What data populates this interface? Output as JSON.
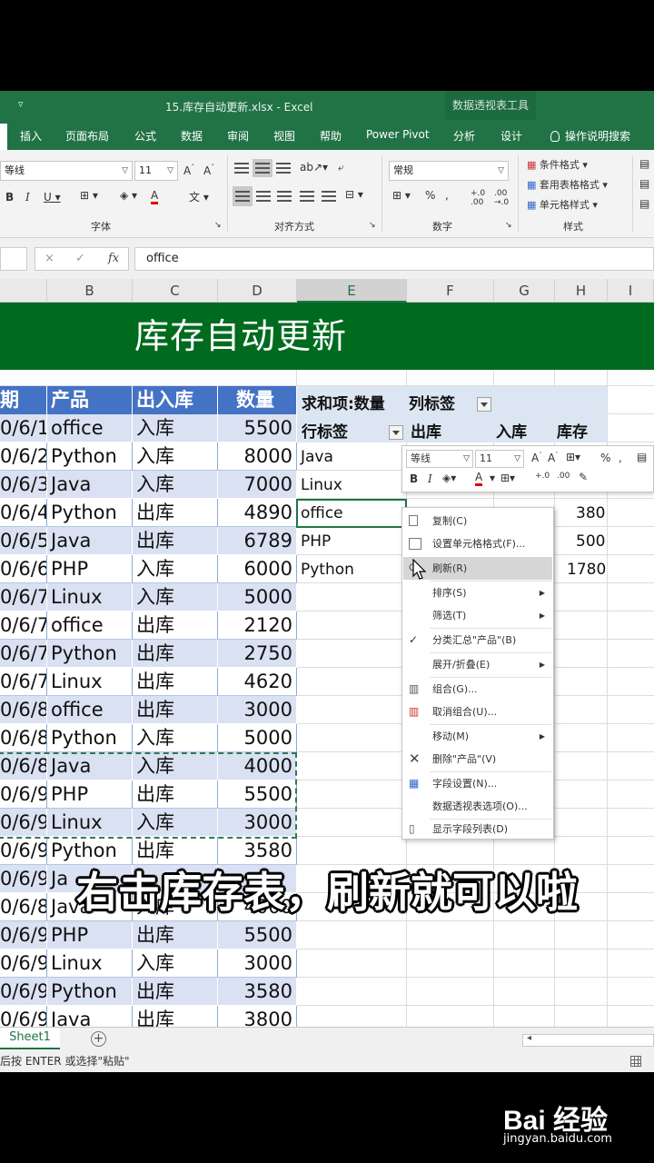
{
  "window": {
    "title": "15.库存自动更新.xlsx  -  Excel",
    "context_tools": "数据透视表工具",
    "quick_access": "▿"
  },
  "ribbon_tabs": [
    "插入",
    "页面布局",
    "公式",
    "数据",
    "审阅",
    "视图",
    "帮助",
    "Power Pivot",
    "分析",
    "设计"
  ],
  "tell_me": "操作说明搜索",
  "ribbon": {
    "font_name": "等线",
    "font_size": "11",
    "font_group": "字体",
    "align_group": "对齐方式",
    "number_format": "常规",
    "number_group": "数字",
    "styles": [
      "条件格式 ▾",
      "套用表格格式 ▾",
      "单元格样式 ▾"
    ],
    "styles_group": "样式"
  },
  "formula_bar": {
    "value": "office",
    "fx": "fx",
    "cancel": "×",
    "enter": "✓"
  },
  "columns": [
    "B",
    "C",
    "D",
    "E",
    "F",
    "G",
    "H",
    "I"
  ],
  "banner_title": "库存自动更新",
  "table": {
    "headers": [
      "期",
      "产品",
      "出入库",
      "数量"
    ],
    "rows": [
      [
        "0/6/1",
        "office",
        "入库",
        "5500"
      ],
      [
        "0/6/2",
        "Python",
        "入库",
        "8000"
      ],
      [
        "0/6/3",
        "Java",
        "入库",
        "7000"
      ],
      [
        "0/6/4",
        "Python",
        "出库",
        "4890"
      ],
      [
        "0/6/5",
        "Java",
        "出库",
        "6789"
      ],
      [
        "0/6/6",
        "PHP",
        "入库",
        "6000"
      ],
      [
        "0/6/7",
        "Linux",
        "入库",
        "5000"
      ],
      [
        "0/6/7",
        "office",
        "出库",
        "2120"
      ],
      [
        "0/6/7",
        "Python",
        "出库",
        "2750"
      ],
      [
        "0/6/7",
        "Linux",
        "出库",
        "4620"
      ],
      [
        "0/6/8",
        "office",
        "出库",
        "3000"
      ],
      [
        "0/6/8",
        "Python",
        "入库",
        "5000"
      ],
      [
        "0/6/8",
        "Java",
        "入库",
        "4000"
      ],
      [
        "0/6/9",
        "PHP",
        "出库",
        "5500"
      ],
      [
        "0/6/9",
        "Linux",
        "入库",
        "3000"
      ],
      [
        "0/6/9",
        "Python",
        "出库",
        "3580"
      ],
      [
        "0/6/9",
        "Ja",
        "",
        ""
      ],
      [
        "0/6/8",
        "Java",
        "入库",
        "4000"
      ],
      [
        "0/6/9",
        "PHP",
        "出库",
        "5500"
      ],
      [
        "0/6/9",
        "Linux",
        "入库",
        "3000"
      ],
      [
        "0/6/9",
        "Python",
        "出库",
        "3580"
      ],
      [
        "0/6/9",
        "Java",
        "出库",
        "3800"
      ]
    ]
  },
  "pivot": {
    "values_label": "求和项:数量",
    "col_label": "列标签",
    "row_label": "行标签",
    "col_headers": [
      "出库",
      "入库",
      "库存"
    ],
    "row_items": [
      "Java",
      "Linux",
      "office",
      "PHP",
      "Python"
    ],
    "visible_stock": [
      "380",
      "500",
      "1780"
    ]
  },
  "mini_toolbar": {
    "font": "等线",
    "size": "11",
    "percent": "%"
  },
  "context_menu": {
    "items": [
      {
        "label": "复制(C)",
        "icon": "copy-icon"
      },
      {
        "label": "设置单元格格式(F)...",
        "icon": "format-cells-icon"
      },
      {
        "label": "刷新(R)",
        "icon": "refresh-icon"
      },
      {
        "label": "排序(S)",
        "icon": ""
      },
      {
        "label": "筛选(T)",
        "icon": ""
      },
      {
        "label": "分类汇总\"产品\"(B)",
        "icon": "check-icon"
      },
      {
        "label": "展开/折叠(E)",
        "icon": ""
      },
      {
        "label": "组合(G)...",
        "icon": "group-icon"
      },
      {
        "label": "取消组合(U)...",
        "icon": "ungroup-icon"
      },
      {
        "label": "移动(M)",
        "icon": ""
      },
      {
        "label": "删除\"产品\"(V)",
        "icon": "delete-icon"
      },
      {
        "label": "字段设置(N)...",
        "icon": "field-settings-icon"
      },
      {
        "label": "数据透视表选项(O)...",
        "icon": ""
      },
      {
        "label": "显示字段列表(D)",
        "icon": "field-list-icon"
      }
    ]
  },
  "caption": "右击库存表，刷新就可以啦",
  "sheet_tab": "Sheet1",
  "status_text": "后按 ENTER 或选择\"粘贴\"",
  "watermark": {
    "brand": "Bai 经验",
    "url": "jingyan.baidu.com"
  }
}
